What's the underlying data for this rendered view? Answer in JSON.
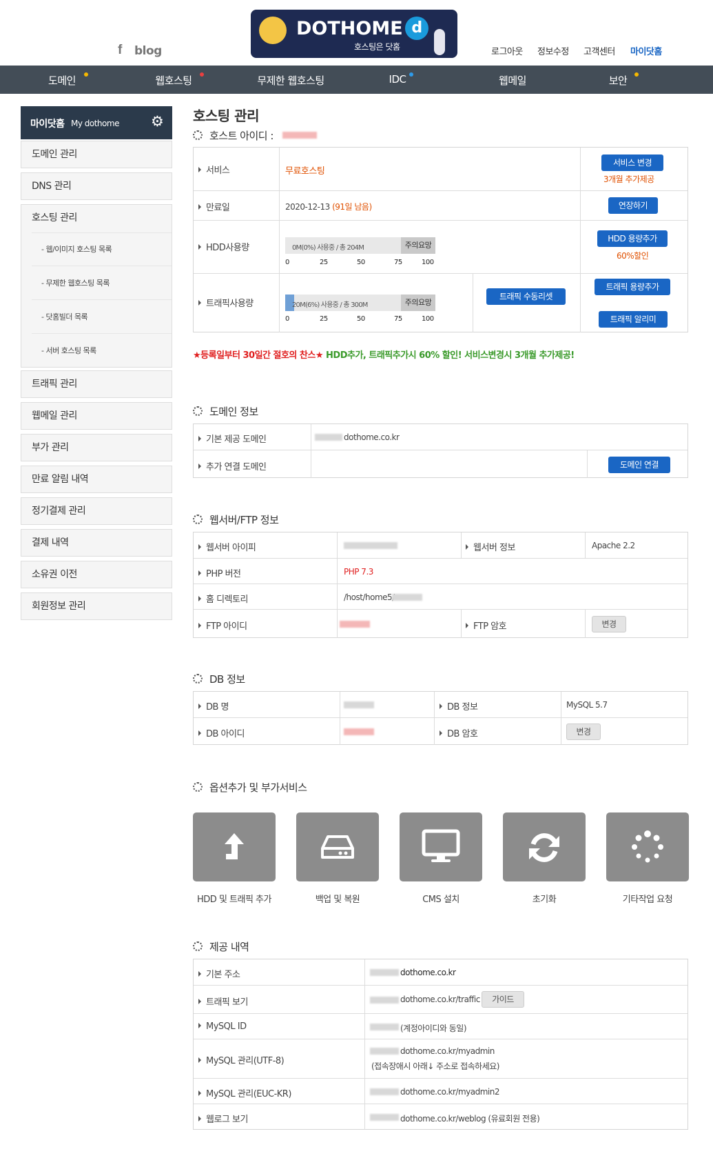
{
  "header": {
    "social": {
      "facebook_icon": "f",
      "blog_label": "blog"
    },
    "logo": {
      "title": "DOTHOME",
      "slogan": "호스팅은 닷홈"
    },
    "top_links": [
      "로그아웃",
      "정보수정",
      "고객센터",
      "마이닷홈"
    ]
  },
  "nav": {
    "items": [
      "도메인",
      "웹호스팅",
      "무제한 웹호스팅",
      "IDC",
      "웹메일",
      "보안"
    ],
    "dot_colors": {
      "yellow": "#f5b800",
      "red": "#e94040",
      "blue": "#2e9bea"
    }
  },
  "sidebar": {
    "head_label": "마이닷홈",
    "head_sub": "My dothome",
    "items": [
      "도메인 관리",
      "DNS 관리",
      "호스팅 관리",
      "트래픽 관리",
      "웹메일 관리",
      "부가 관리",
      "만료 알림 내역",
      "정기결제 관리",
      "결제 내역",
      "소유권 이전",
      "회원정보 관리"
    ],
    "sub_items": [
      "- 웹/이미지 호스팅 목록",
      "- 무제한 웹호스팅 목록",
      "- 닷홈빌더 목록",
      "- 서버 호스팅 목록"
    ]
  },
  "page": {
    "title": "호스팅 관리",
    "host_id_label": "호스트 아이디 :"
  },
  "hosting": {
    "service_label": "서비스",
    "service_value": "무료호스팅",
    "service_btn": "서비스 변경",
    "service_note": "3개월 추가제공",
    "expiry_label": "만료일",
    "expiry_date": "2020-12-13",
    "expiry_remain": "(91일 남음)",
    "extend_btn": "연장하기",
    "hdd_label": "HDD사용량",
    "hdd_text": "0M(0%) 사용중 / 총 204M",
    "hdd_percent": 0,
    "hdd_btn": "HDD 용량추가",
    "hdd_note": "60%할인",
    "traffic_label": "트래픽사용량",
    "traffic_text": "20M(6%) 사용중 / 총 300M",
    "traffic_percent": 6,
    "traffic_reset_btn": "트래픽 수동리셋",
    "traffic_add_btn": "트래픽 용량추가",
    "traffic_alarm_btn": "트래픽 알리미",
    "warn_label": "주의요망",
    "ticks": [
      "0",
      "25",
      "50",
      "75",
      "100"
    ]
  },
  "promo": {
    "red": "★등록일부터 30일간 절호의 찬스★",
    "green": "HDD추가, 트래픽추가시 60% 할인! 서비스변경시 3개월 추가제공!"
  },
  "domain": {
    "title": "도메인 정보",
    "basic_label": "기본 제공 도메인",
    "basic_value": "dothome.co.kr",
    "extra_label": "추가 연결 도메인",
    "connect_btn": "도메인 연결"
  },
  "webserver": {
    "title": "웹서버/FTP 정보",
    "ip_label": "웹서버 아이피",
    "info_label": "웹서버 정보",
    "info_value": "Apache 2.2",
    "php_label": "PHP 버전",
    "php_value": "PHP 7.3",
    "home_label": "홈 디렉토리",
    "home_value": "/host/home5/",
    "ftp_id_label": "FTP 아이디",
    "ftp_pw_label": "FTP 암호",
    "change_btn": "변경"
  },
  "db": {
    "title": "DB 정보",
    "name_label": "DB 명",
    "info_label": "DB 정보",
    "info_value": "MySQL 5.7",
    "id_label": "DB 아이디",
    "pw_label": "DB 암호",
    "change_btn": "변경"
  },
  "options": {
    "title": "옵션추가 및 부가서비스",
    "items": [
      {
        "label": "HDD 및 트래픽 추가",
        "icon": "upload-arrow-icon"
      },
      {
        "label": "백업 및 복원",
        "icon": "hard-drive-icon"
      },
      {
        "label": "CMS 설치",
        "icon": "monitor-icon"
      },
      {
        "label": "초기화",
        "icon": "refresh-icon"
      },
      {
        "label": "기타작업 요청",
        "icon": "loading-dots-icon"
      }
    ]
  },
  "provided": {
    "title": "제공 내역",
    "rows": [
      {
        "label": "기본 주소",
        "value": "dothome.co.kr"
      },
      {
        "label": "트래픽 보기",
        "value": "dothome.co.kr/traffic",
        "btn": "가이드"
      },
      {
        "label": "MySQL ID",
        "value": "(계정아이디와 동일)"
      },
      {
        "label": "MySQL 관리(UTF-8)",
        "value": "dothome.co.kr/myadmin",
        "note": "(접속장애시 아래↓ 주소로 접속하세요)"
      },
      {
        "label": "MySQL 관리(EUC-KR)",
        "value": "dothome.co.kr/myadmin2"
      },
      {
        "label": "웹로그 보기",
        "value": "dothome.co.kr/weblog (유료회원 전용)"
      }
    ]
  }
}
